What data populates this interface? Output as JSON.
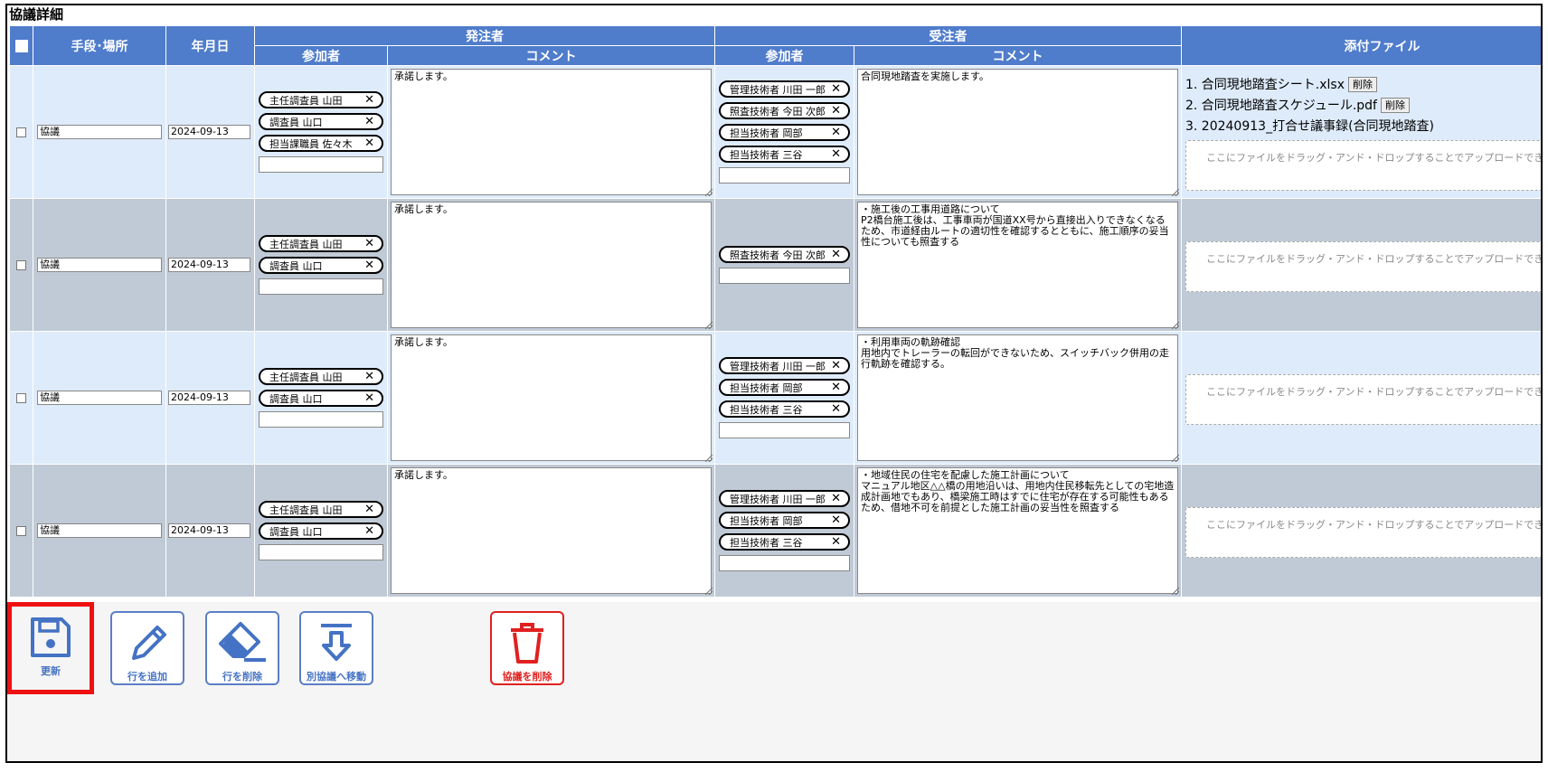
{
  "section_title": "協議詳細",
  "headers": {
    "method_place": "手段･場所",
    "date": "年月日",
    "orderer": "発注者",
    "contractor": "受注者",
    "participants": "参加者",
    "comment": "コメント",
    "attachments": "添付ファイル"
  },
  "rows": [
    {
      "method": "協議",
      "date": "2024-09-13",
      "orderer_participants": [
        "主任調査員 山田",
        "調査員 山口",
        "担当課職員 佐々木"
      ],
      "orderer_comment": "承諾します。",
      "contractor_participants": [
        "管理技術者 川田 一郎",
        "照査技術者 今田 次郎",
        "担当技術者 岡部",
        "担当技術者 三谷"
      ],
      "contractor_comment": "合同現地踏査を実施します。",
      "files": [
        {
          "name": "1. 合同現地踏査シート.xlsx",
          "delete": "削除"
        },
        {
          "name": "2. 合同現地踏査スケジュール.pdf",
          "delete": "削除"
        },
        {
          "name": "3. 20240913_打合せ議事録(合同現地踏査)",
          "delete": ""
        }
      ],
      "drop_hint": "ここにファイルをドラッグ・アンド・ドロップすることでアップロードできます"
    },
    {
      "method": "協議",
      "date": "2024-09-13",
      "orderer_participants": [
        "主任調査員 山田",
        "調査員 山口"
      ],
      "orderer_comment": "承諾します。",
      "contractor_participants": [
        "照査技術者 今田 次郎"
      ],
      "contractor_comment": "・施工後の工事用道路について\nP2橋台施工後は、工事車両が国道XX号から直接出入りできなくなるため、市道経由ルートの適切性を確認するとともに、施工順序の妥当性についても照査する",
      "files": [],
      "drop_hint": "ここにファイルをドラッグ・アンド・ドロップすることでアップロードできます"
    },
    {
      "method": "協議",
      "date": "2024-09-13",
      "orderer_participants": [
        "主任調査員 山田",
        "調査員 山口"
      ],
      "orderer_comment": "承諾します。",
      "contractor_participants": [
        "管理技術者 川田 一郎",
        "担当技術者 岡部",
        "担当技術者 三谷"
      ],
      "contractor_comment": "・利用車両の軌跡確認\n用地内でトレーラーの転回ができないため、スイッチバック併用の走行軌跡を確認する。",
      "files": [],
      "drop_hint": "ここにファイルをドラッグ・アンド・ドロップすることでアップロードできます"
    },
    {
      "method": "協議",
      "date": "2024-09-13",
      "orderer_participants": [
        "主任調査員 山田",
        "調査員 山口"
      ],
      "orderer_comment": "承諾します。",
      "contractor_participants": [
        "管理技術者 川田 一郎",
        "担当技術者 岡部",
        "担当技術者 三谷"
      ],
      "contractor_comment": "・地域住民の住宅を配慮した施工計画について\nマニュアル地区△△橋の用地沿いは、用地内住民移転先としての宅地造成計画地でもあり、橋梁施工時はすでに住宅が存在する可能性もあるため、借地不可を前提とした施工計画の妥当性を照査する",
      "files": [],
      "drop_hint": "ここにファイルをドラッグ・アンド・ドロップすることでアップロードできます"
    }
  ],
  "toolbar": {
    "update": "更新",
    "add_row": "行を追加",
    "delete_row": "行を削除",
    "move": "別協議へ移動",
    "delete_meeting": "協議を削除"
  },
  "colors": {
    "header": "#4f7ccb",
    "row_light": "#deebfa",
    "row_gray": "#c0cad6",
    "button_blue": "#4472c4",
    "danger": "#e02020",
    "highlight": "#ee1111"
  }
}
